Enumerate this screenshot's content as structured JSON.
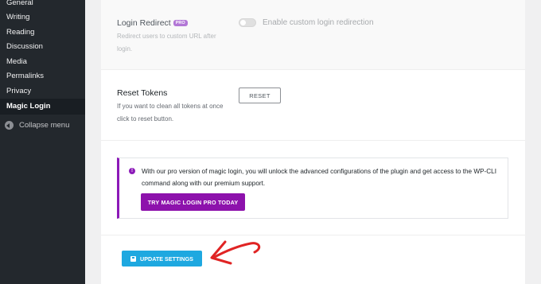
{
  "sidebar": {
    "items": [
      {
        "label": "General"
      },
      {
        "label": "Writing"
      },
      {
        "label": "Reading"
      },
      {
        "label": "Discussion"
      },
      {
        "label": "Media"
      },
      {
        "label": "Permalinks"
      },
      {
        "label": "Privacy"
      },
      {
        "label": "Magic Login"
      }
    ],
    "active": "Magic Login",
    "collapse_label": "Collapse menu"
  },
  "login_redirect": {
    "label": "Login Redirect",
    "badge": "PRO",
    "description": "Redirect users to custom URL after login.",
    "toggle_label": "Enable custom login redirection",
    "toggle_on": false
  },
  "reset_tokens": {
    "label": "Reset Tokens",
    "description": "If you want to clean all tokens at once click to reset button.",
    "button_label": "RESET"
  },
  "notice": {
    "icon": "info-icon",
    "text": "With our pro version of magic login, you will unlock the advanced configurations of the plugin and get access to the WP-CLI command along with our premium support.",
    "button_label": "TRY MAGIC LOGIN PRO TODAY"
  },
  "update": {
    "button_label": "UPDATE SETTINGS",
    "icon": "save-icon"
  },
  "colors": {
    "sidebar_bg": "#23282d",
    "accent_purple": "#8d12ac",
    "update_blue": "#1ea8e0",
    "arrow_red": "#e02424"
  }
}
